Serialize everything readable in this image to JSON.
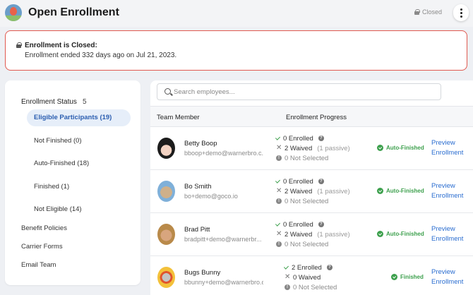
{
  "header": {
    "title": "Open Enrollment",
    "status_label": "Closed"
  },
  "alert": {
    "title": "Enrollment is Closed:",
    "message": "Enrollment ended 332 days ago on Jul 21, 2023."
  },
  "sidebar": {
    "status_heading": "Enrollment Status",
    "status_count": "5",
    "filters": [
      {
        "label": "Eligible Participants (19)",
        "active": true
      },
      {
        "label": "Not Finished (0)"
      },
      {
        "label": "Auto-Finished (18)"
      },
      {
        "label": "Finished (1)"
      },
      {
        "label": "Not Eligible (14)"
      }
    ],
    "links": [
      {
        "label": "Benefit Policies"
      },
      {
        "label": "Carrier Forms"
      },
      {
        "label": "Email Team"
      }
    ]
  },
  "search": {
    "placeholder": "Search employees..."
  },
  "table": {
    "columns": [
      "Team Member",
      "Enrollment Progress"
    ],
    "rows": [
      {
        "name": "Betty Boop",
        "email": "bboop+demo@warnerbro.c...",
        "enrolled": "0 Enrolled",
        "waived": "2 Waived",
        "passive": "(1 passive)",
        "not_selected": "0 Not Selected",
        "status": "Auto-Finished",
        "action_line1": "Preview",
        "action_line2": "Enrollment"
      },
      {
        "name": "Bo Smith",
        "email": "bo+demo@goco.io",
        "enrolled": "0 Enrolled",
        "waived": "2 Waived",
        "passive": "(1 passive)",
        "not_selected": "0 Not Selected",
        "status": "Auto-Finished",
        "action_line1": "Preview",
        "action_line2": "Enrollment"
      },
      {
        "name": "Brad Pitt",
        "email": "bradpitt+demo@warnerbr...",
        "enrolled": "0 Enrolled",
        "waived": "2 Waived",
        "passive": "(1 passive)",
        "not_selected": "0 Not Selected",
        "status": "Auto-Finished",
        "action_line1": "Preview",
        "action_line2": "Enrollment"
      },
      {
        "name": "Bugs Bunny",
        "email": "bbunny+demo@warnerbro.c...",
        "enrolled": "2 Enrolled",
        "waived": "0 Waived",
        "passive": "",
        "not_selected": "0 Not Selected",
        "status": "Finished",
        "action_line1": "Preview",
        "action_line2": "Enrollment"
      }
    ]
  },
  "colors": {
    "accent": "#2a6dd0",
    "success": "#3da04d",
    "alert_border": "#e0594f"
  }
}
